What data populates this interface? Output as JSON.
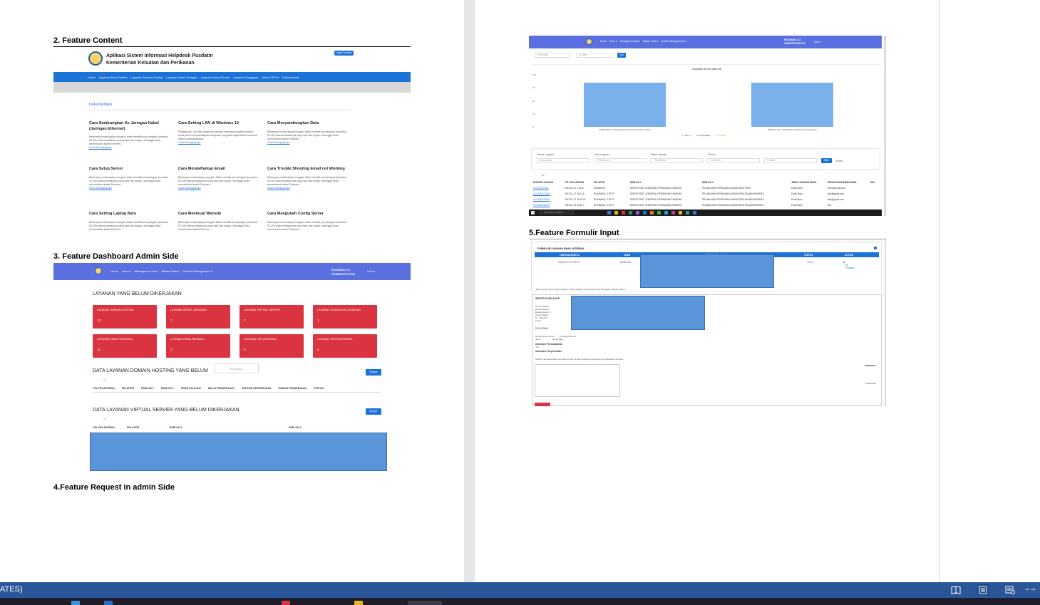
{
  "headings": {
    "feature_content": "2.  Feature Content",
    "dashboard": "3. Feature Dashboard Admin Side",
    "request": "4.Feature Request in admin Side",
    "formulir": "5.Feature Formulir Input"
  },
  "content_site": {
    "title_line1": "Aplikasi Sistem Informasi Helpdesk Pusdatin",
    "title_line2": "Kementerian Keluatan dan Perikanan",
    "login_button": "Login Pusdatin",
    "nav": [
      "Home",
      "Layanan Akun Email ▾",
      "Layanan Domain Hosting",
      "Layanan Akses Jaringan",
      "Layanan Virtual Server",
      "Layanan Gangguan",
      "Akses VPN ▾",
      "Dokumentasi"
    ],
    "breadcrumb": "Dokumentasi",
    "read_more": "Lihat Selengkapnya",
    "cards": [
      {
        "title": "Cara Sambungkan Ke Jaringan Kabel (Jaringan Ethernet)",
        "text": "Beberapa model laptop mungkin tidak memiliki port jaringan (konektor RJ-45) karena desainnya yang tipis dan ringan, sehingga Anda memerlukan kabel Ethernet..."
      },
      {
        "title": "Cara Setting LAN di Windows 10",
        "text": "Pengaturan LAN bisa dilakukan dengan beberapa langkah mudah. Anda perlu mempersiapkan komputer yang akan digunakan termasuk kabel penghubungnya..."
      },
      {
        "title": "Cara Menyambungkan Data",
        "text": "Beberapa model laptop mungkin tidak memiliki port jaringan (konektor RJ-45) karena desainnya yang tipis dan ringan, sehingga Anda memerlukan kabel Ethernet..."
      },
      {
        "title": "Cara Setup Server",
        "text": "Beberapa model laptop mungkin tidak memiliki port jaringan (konektor RJ-45) karena desainnya yang tipis dan ringan, sehingga Anda memerlukan kabel Ethernet..."
      },
      {
        "title": "Cara Mendaftarkan Email",
        "text": "Beberapa model laptop mungkin tidak memiliki port jaringan (konektor RJ-45) karena desainnya yang tipis dan ringan, sehingga Anda memerlukan kabel Ethernet..."
      },
      {
        "title": "Cara Trouble Shooting Email not Working",
        "text": "Beberapa model laptop mungkin tidak memiliki port jaringan (konektor RJ-45) karena desainnya yang tipis dan ringan, sehingga Anda memerlukan kabel Ethernet..."
      },
      {
        "title": "Cara Setting Laptop Baru",
        "text": "Beberapa model laptop mungkin tidak memiliki port jaringan (konektor RJ-45) karena desainnya yang tipis dan ringan, sehingga Anda memerlukan kabel Ethernet..."
      },
      {
        "title": "Cara Membuat Website",
        "text": "Beberapa model laptop mungkin tidak memiliki port jaringan (konektor RJ-45) karena desainnya yang tipis dan ringan, sehingga Anda memerlukan kabel Ethernet..."
      },
      {
        "title": "Cara Mengubah Config Server",
        "text": "Beberapa model laptop mungkin tidak memiliki port jaringan (konektor RJ-45) karena desainnya yang tipis dan ringan, sehingga Anda memerlukan kabel Ethernet..."
      }
    ]
  },
  "admin_nav": {
    "items": [
      "Home",
      "Inbox ▾",
      "Management User",
      "Master Data ▾",
      "Content Management ▾"
    ],
    "user_name": "ROSIMAN, S.I",
    "user_role": "ADMINISTRATOR",
    "flag": "Indo ▾"
  },
  "dashboard": {
    "pending_heading": "LAYANAN YANG BELUM DIKERJAKAN",
    "cards": [
      {
        "title": "LAYANAN DOMAIN HOSTING",
        "value": "12"
      },
      {
        "title": "LAYANAN AKSES JARINGAN",
        "value": "1"
      },
      {
        "title": "LAYANAN VIRTUAL SERVER",
        "value": "7"
      },
      {
        "title": "LAYANAN GANGGUAN JARINGAN",
        "value": "1"
      },
      {
        "title": "LAYANAN EMAIL PERSONAL",
        "value": "11"
      },
      {
        "title": "LAYANAN EMAIL INSTANSI",
        "value": "3"
      },
      {
        "title": "LAYANAN VPN INTERNAL",
        "value": "9"
      },
      {
        "title": "LAYANAN VPN EKSTERNAL",
        "value": "4"
      }
    ],
    "domain_heading": "DATA LAYANAN DOMAIN HOSTING YANG BELUM",
    "processing": "Processing...",
    "export": "Export",
    "show_entries": "10",
    "domain_columns": [
      "TGL PELAPORAN",
      "PELAPOR",
      "ESELON 1",
      "ESELON 2",
      "JENIS APLIKASI",
      "MULAI PENGERJAAN",
      "SELESAI PENGERJAAN",
      "DURASI PENGERJAAN",
      "STATUS"
    ],
    "vs_heading": "DATA LAYANAN VIRTUAL SERVER YANG BELUM DIKERJAKAN",
    "vs_columns": [
      "TGL PELAPORAN",
      "PELAPOR",
      "ESELON 1",
      "ESELON 2"
    ]
  },
  "report": {
    "from_date": "From Date",
    "to_date": "To Date",
    "cari": "Cari",
    "filter_labels": [
      "Nomor Layanan",
      "Jenis Layanan",
      "Status Layanan",
      "Periode"
    ],
    "filter_placeholders": [
      "No Layanan",
      "- Pilih Status -",
      "- Pilih Status -",
      "From Date",
      "To Date"
    ],
    "filter_button": "Filter",
    "export": "Export",
    "show_entries": "10",
    "columns": [
      "NOMOR LAYANAN",
      "TGL PELAPORAN",
      "PELAPOR",
      "ESELON 1",
      "ESELON 2",
      "JENIS LAYANAN EMAIL",
      "PENGAJUAN NAMA EMAIL",
      "MUI"
    ],
    "rows": [
      [
        "LEI-202307001",
        "2023-02-07 1:26:57",
        "SUMARNO",
        "DIREKTORAT JENDERAL PERIKANAN TANGKAP",
        "PELABUHAN PERIKANAN NUSANTARA PRIGI",
        "Email Baru",
        "zeno@gmail.com"
      ],
      [
        "LEI-202311700Z",
        "2023-01-17 11:01:6",
        "RUKMANA, S.ST.PI",
        "DIREKTORAT JENDERAL PERIKANAN TANGKAP",
        "PELABUHAN PERIKANAN NUSANTARA PALABUHANRATU",
        "Email Baru",
        "test@gmail.com"
      ],
      [
        "LEI-202311700Y",
        "2023-01-17 11:25:42",
        "RUKMANA, S.ST.PI",
        "DIREKTORAT JENDERAL PERIKANAN TANGKAP",
        "PELABUHAN PERIKANAN NUSANTARA PALABUHANRATU",
        "Email Baru",
        "test@gmail.com"
      ],
      [
        "LEI-202311600T",
        "2023-01-16 16:44:7",
        "RUKMANA, S.ST.PI",
        "DIREKTORAT JENDERAL PERIKANAN TANGKAP",
        "PELABUHAN PERIKANAN NUSANTARA PALABUHANRATU",
        "Email Baru",
        "test"
      ]
    ],
    "taskbar_search": "Type here to search"
  },
  "chart_data": {
    "type": "bar",
    "title": "Layanan Email Internal",
    "categories": [
      "DIREKTORAT JENDERAL PENGUATAN DAYA SAING",
      "DIREKTORAT JENDERAL PERIKANAN TANGKAP"
    ],
    "series": [
      {
        "name": "Belum",
        "values": [
          85,
          85
        ]
      }
    ],
    "legend": [
      "Belum",
      "Pengerjaan",
      "Selesai"
    ],
    "yticks": [
      "100",
      "75",
      "50",
      "25",
      "0"
    ],
    "ylim": [
      0,
      100
    ]
  },
  "formulir": {
    "title": "FORMULIR LAYANAN EMAIL INTERNAL",
    "columns": [
      "TANGGAL/WAKTU",
      "JENIS",
      "FORMULIR LAYANAN",
      "STATUS",
      "ACTION"
    ],
    "row": {
      "datetime": "2023-02-07 01:20:57",
      "jenis": "Email Baru",
      "status": "To Do",
      "action": "On Progress"
    },
    "note": "Bersama formulir ini kami lakukan untuk melayani mana Email yang berlaggan dengan Sistem...",
    "identitas": "IDENTITAS PELAPOR",
    "identitas_fields": "Nama Pelapor\nEselon Eselon I\nEselon Eselon II\nNama Bagian\nNo. Telp/HP\nEmail",
    "data_email": "DATA EMAIL",
    "email_fields": "Usulan Nama Email       : zeno@gmail.com\nJenis                   : Email Baru",
    "info_permasalahan": "Informasi Permasalahan",
    "info_permasalahan_val": "test",
    "info_penyelesaian": "Informasi Penyelesaian",
    "disclaimer": "Mohon mencantumkan informasi di atas ini atau sebelumnya dengan penyelesaian informasi",
    "penerima": "PENERIMA",
    "signer": "SUMARNO"
  },
  "statusbar": {
    "language": "ATES)"
  }
}
